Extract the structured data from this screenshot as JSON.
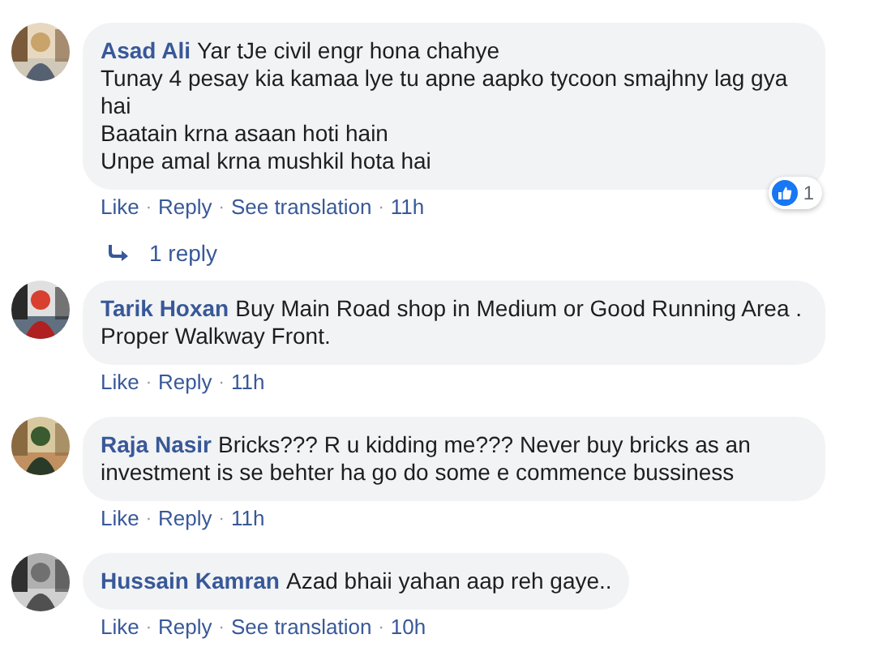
{
  "comments": [
    {
      "author": "Asad Ali",
      "text": "Yar tJe civil engr hona chahye\nTunay 4 pesay kia kamaa lye tu apne aapko tycoon smajhny lag gya hai\nBaatain krna asaan hoti hain\nUnpe amal krna mushkil hota hai",
      "actions": [
        {
          "kind": "link",
          "text": "Like"
        },
        {
          "kind": "separator",
          "text": "·"
        },
        {
          "kind": "link",
          "text": "Reply"
        },
        {
          "kind": "separator",
          "text": "·"
        },
        {
          "kind": "link",
          "text": "See translation"
        },
        {
          "kind": "separator",
          "text": "·"
        },
        {
          "kind": "time",
          "text": "11h"
        }
      ],
      "reactions": {
        "count": "1"
      },
      "replies": "1 reply"
    },
    {
      "author": "Tarik Hoxan",
      "text": "Buy Main Road shop in Medium or Good Running Area . Proper Walkway Front.",
      "actions": [
        {
          "kind": "link",
          "text": "Like"
        },
        {
          "kind": "separator",
          "text": "·"
        },
        {
          "kind": "link",
          "text": "Reply"
        },
        {
          "kind": "separator",
          "text": "·"
        },
        {
          "kind": "time",
          "text": "11h"
        }
      ]
    },
    {
      "author": "Raja Nasir",
      "text": "Bricks??? R u kidding me??? Never buy bricks as an investment is se behter ha go do some e commence bussiness",
      "actions": [
        {
          "kind": "link",
          "text": "Like"
        },
        {
          "kind": "separator",
          "text": "·"
        },
        {
          "kind": "link",
          "text": "Reply"
        },
        {
          "kind": "separator",
          "text": "·"
        },
        {
          "kind": "time",
          "text": "11h"
        }
      ]
    },
    {
      "author": "Hussain Kamran",
      "text": "Azad bhaii yahan aap reh gaye..",
      "actions": [
        {
          "kind": "link",
          "text": "Like"
        },
        {
          "kind": "separator",
          "text": "·"
        },
        {
          "kind": "link",
          "text": "Reply"
        },
        {
          "kind": "separator",
          "text": "·"
        },
        {
          "kind": "link",
          "text": "See translation"
        },
        {
          "kind": "separator",
          "text": "·"
        },
        {
          "kind": "time",
          "text": "10h"
        }
      ]
    }
  ]
}
